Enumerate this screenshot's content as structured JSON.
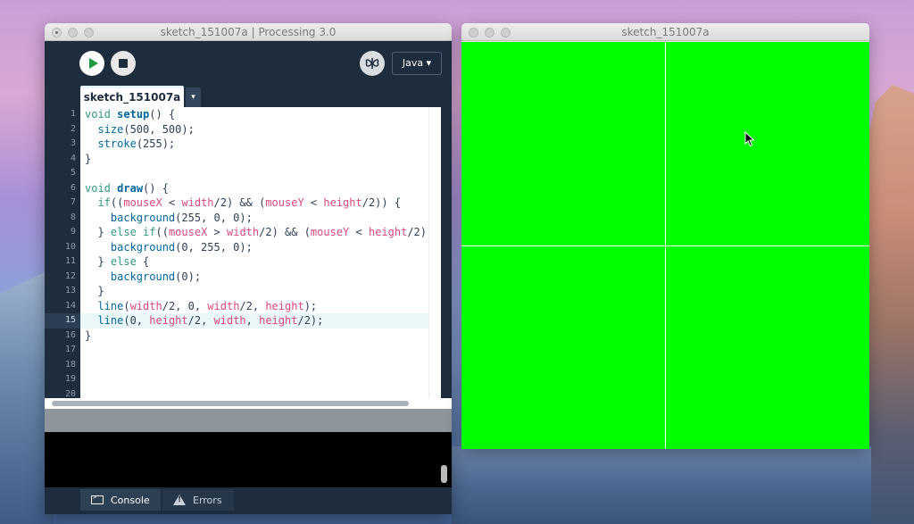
{
  "ide": {
    "title": "sketch_151007a | Processing 3.0",
    "toolbar": {
      "run_icon": "play-icon",
      "stop_icon": "stop-icon",
      "debug_icon": "butterfly-icon",
      "mode": "Java ▾"
    },
    "tab": {
      "name": "sketch_151007a",
      "menu_glyph": "▾"
    },
    "line_numbers": [
      "1",
      "2",
      "3",
      "4",
      "5",
      "6",
      "7",
      "8",
      "9",
      "10",
      "11",
      "12",
      "13",
      "14",
      "15",
      "16",
      "17",
      "18",
      "19",
      "20"
    ],
    "current_line": 15,
    "console_tab": "Console",
    "errors_tab": "Errors"
  },
  "code": {
    "l1": [
      "void",
      "setup",
      "() {"
    ],
    "l2": [
      "  ",
      "size",
      "(500, 500);"
    ],
    "l3": [
      "  ",
      "stroke",
      "(255);"
    ],
    "l4": "}",
    "l6": [
      "void",
      "draw",
      "() {"
    ],
    "l7": [
      "  ",
      "if",
      "((",
      "mouseX",
      " < ",
      "width",
      "/2) && (",
      "mouseY",
      " < ",
      "height",
      "/2)) {"
    ],
    "l8": [
      "    ",
      "background",
      "(255, 0, 0);"
    ],
    "l9": [
      "  } ",
      "else",
      " ",
      "if",
      "((",
      "mouseX",
      " > ",
      "width",
      "/2) && (",
      "mouseY",
      " < ",
      "height",
      "/2)"
    ],
    "l10": [
      "    ",
      "background",
      "(0, 255, 0);"
    ],
    "l11": [
      "  } ",
      "else",
      " {"
    ],
    "l12": [
      "    ",
      "background",
      "(0);"
    ],
    "l13": "  }",
    "l14": [
      "  ",
      "line",
      "(",
      "width",
      "/2, 0, ",
      "width",
      "/2, ",
      "height",
      ");"
    ],
    "l15": [
      "  ",
      "line",
      "(0, ",
      "height",
      "/2, ",
      "width",
      ", ",
      "height",
      "/2);"
    ],
    "l16": "}"
  },
  "sketch": {
    "title": "sketch_151007a",
    "background_color": "#00fe00",
    "stroke_color": "#ffffff",
    "cursor_icon": "arrow-cursor-icon"
  },
  "colors": {
    "ide_bg": "#1e2d3e",
    "keyword": "#33997e",
    "function": "#006699",
    "variable": "#d94a7a"
  }
}
